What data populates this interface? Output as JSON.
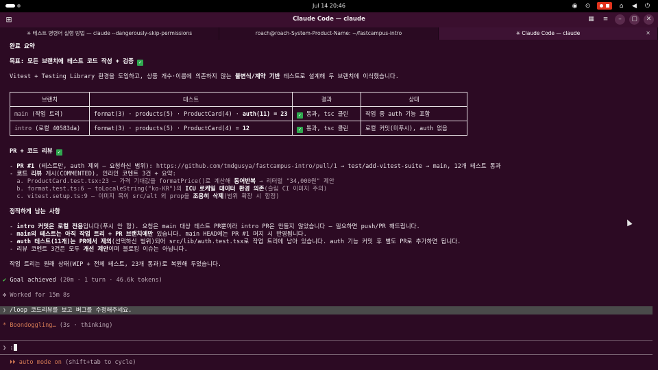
{
  "system": {
    "clock": "Jul 14  20:46"
  },
  "window": {
    "title": "Claude Code — claude"
  },
  "tabs": [
    {
      "label": "✳ 테스트 명령어 실행 방법 — claude --dangerously-skip-permissions"
    },
    {
      "label": "roach@roach-System-Product-Name: ~/fastcampus-intro"
    },
    {
      "label": "✳ Claude Code — claude"
    }
  ],
  "terminal": {
    "heading_summary": "완료 요약",
    "goal_prefix": "목표: 모든 브랜치에 테스트 코드 작성 + 검증 ",
    "intro_pre": "Vitest + Testing Library 환경을 도입하고, 상품 개수·이름에 의존하지 않는 ",
    "intro_bold": "불변식/계약 기반",
    "intro_post": " 테스트로 설계해 두 브랜치에 이식했습니다.",
    "table": {
      "headers": [
        "브랜치",
        "테스트",
        "결과",
        "상태"
      ],
      "rows": [
        {
          "branch_code": "main",
          "branch_rest": " (작업 트리)",
          "tests_pre": "format(3) · products(5) · ProductCard(4) · ",
          "tests_bold": "auth(11) = 23",
          "result_check": "✅",
          "result_text": " 통과, tsc 클린",
          "status": "작업 중 auth 기능 포함"
        },
        {
          "branch_code": "intro",
          "branch_rest": " (로컬 40583da)",
          "tests_pre": "format(3) · products(5) · ProductCard(4) = ",
          "tests_bold": "12",
          "result_check": "✅",
          "result_text": " 통과, tsc 클린",
          "status": "로컬 커밋(미푸시), auth 없음"
        }
      ]
    },
    "pr_heading": "PR + 코드 리뷰 ",
    "pr_lines": {
      "l1_a": "- ",
      "l1_b": "PR #1",
      "l1_c": " (테스트만, auth 제외 — 요청하신 범위): ",
      "l1_url": "https://github.com/tmdgusya/fastcampus-intro/pull/1",
      "l1_d": " → test/add-vitest-suite → main, 12개 테스트 통과",
      "l2_a": "- ",
      "l2_b": "코드 리뷰",
      "l2_c": " 게시(COMMENTED), 인라인 코멘트 3건 + 요약:",
      "l3": "  a. ProductCard.test.tsx:23 — 가격 기대값을 formatPrice()로 계산해 ",
      "l3_b": "동어반복",
      "l3_c": " → 리터럴 \"34,000원\" 제안",
      "l4": "  b. format.test.ts:6 — toLocaleString(\"ko-KR\")의 ",
      "l4_b": "ICU 로케일 데이터 환경 의존",
      "l4_c": "(슬림 CI 이미지 주의)",
      "l5": "  c. vitest.setup.ts:9 — 이미지 목이 src/alt 외 prop을 ",
      "l5_b": "조용히 삭제",
      "l5_c": "(범위 확장 시 함정)"
    },
    "honest_heading": "정직하게 남는 사항",
    "honest_lines": {
      "h1_a": "- ",
      "h1_b": "intro 커밋은 로컬 전용",
      "h1_c": "입니다(푸시 안 함). 요청은 main 대상 테스트 PR뿐이라 intro PR은 만들지 않았습니다 — 필요하면 push/PR 해드립니다.",
      "h2_a": "- ",
      "h2_b": "main의 테스트는 아직 작업 트리 + PR 브랜치에만",
      "h2_c": " 있습니다. main HEAD에는 PR #1 머지 시 반영됩니다.",
      "h3_a": "- ",
      "h3_b": "auth 테스트(11개)는 PR에서 제외",
      "h3_c": "(선택하신 범위)되어 src/lib/auth.test.tsx로 작업 트리에 남아 있습니다. auth 기능 커밋 후 별도 PR로 추가하면 됩니다.",
      "h4_a": "- 리뷰 코멘트 3건은 모두 ",
      "h4_b": "개선 제안",
      "h4_c": "이며 블로킹 이슈는 아닙니다."
    },
    "restore_line": "작업 트리는 원래 상태(WIP + 전체 테스트, 23개 통과)로 복원해 두었습니다.",
    "goal_achieved": "Goal achieved",
    "goal_meta": " (20m · 1 turn · 46.6k tokens)",
    "worked_for": "Worked for 15m 8s",
    "user_prompt": "/loop 코드리뷰를 보고 버그를 수정해주세요.",
    "thinking_label": "Boondoggling…",
    "thinking_meta": " (3s · thinking)",
    "input_prompt": "❯",
    "input_value": ":",
    "mode_arrows": "⏵⏵",
    "mode_label": "auto mode on",
    "mode_hint": " (shift+tab to cycle)"
  },
  "colors": {
    "terminal_bg": "#2c0a23",
    "titlebar_bg": "#3a0f2e",
    "success_green": "#4ec94e",
    "mode_orange": "#d47a55"
  }
}
